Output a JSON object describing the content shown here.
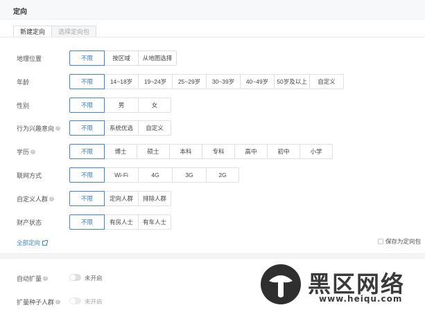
{
  "header": {
    "title": "定向"
  },
  "tabs": [
    {
      "label": "新建定向",
      "active": true
    },
    {
      "label": "选择定向包",
      "active": false
    }
  ],
  "rows": {
    "location": {
      "label": "地理位置",
      "options": [
        "不限",
        "按区域",
        "从地图选择"
      ],
      "selected": "不限"
    },
    "age": {
      "label": "年龄",
      "options": [
        "不限",
        "14~18岁",
        "19~24岁",
        "25~29岁",
        "30~39岁",
        "40~49岁",
        "50岁及以上",
        "自定义"
      ],
      "selected": "不限"
    },
    "gender": {
      "label": "性别",
      "options": [
        "不限",
        "男",
        "女"
      ],
      "selected": "不限"
    },
    "interest": {
      "label": "行为兴趣意向",
      "options": [
        "不限",
        "系统优选",
        "自定义"
      ],
      "selected": "不限"
    },
    "education": {
      "label": "学历",
      "options": [
        "不限",
        "博士",
        "硕士",
        "本科",
        "专科",
        "高中",
        "初中",
        "小学"
      ],
      "selected": "不限"
    },
    "network": {
      "label": "联网方式",
      "options": [
        "不限",
        "Wi-Fi",
        "4G",
        "3G",
        "2G"
      ],
      "selected": "不限"
    },
    "custom_audience": {
      "label": "自定义人群",
      "options": [
        "不限",
        "定向人群",
        "排除人群"
      ],
      "selected": "不限"
    },
    "assets": {
      "label": "财产状态",
      "options": [
        "不限",
        "有房人士",
        "有车人士"
      ],
      "selected": "不限"
    }
  },
  "links": {
    "all_targeting": "全部定向"
  },
  "save_package": {
    "label": "保存为定向包",
    "checked": false
  },
  "switches": {
    "auto_expand": {
      "label": "自动扩量",
      "state": "未开启",
      "on": false
    },
    "seed_audience": {
      "label": "扩量种子人群",
      "state": "未开启",
      "on": false
    }
  },
  "watermark": {
    "text": "黑区网络",
    "url": "www.heiqu.com"
  },
  "colors": {
    "accent": "#3b82d9",
    "border": "#dcdfe6",
    "header_bg": "#f7f8fa"
  }
}
